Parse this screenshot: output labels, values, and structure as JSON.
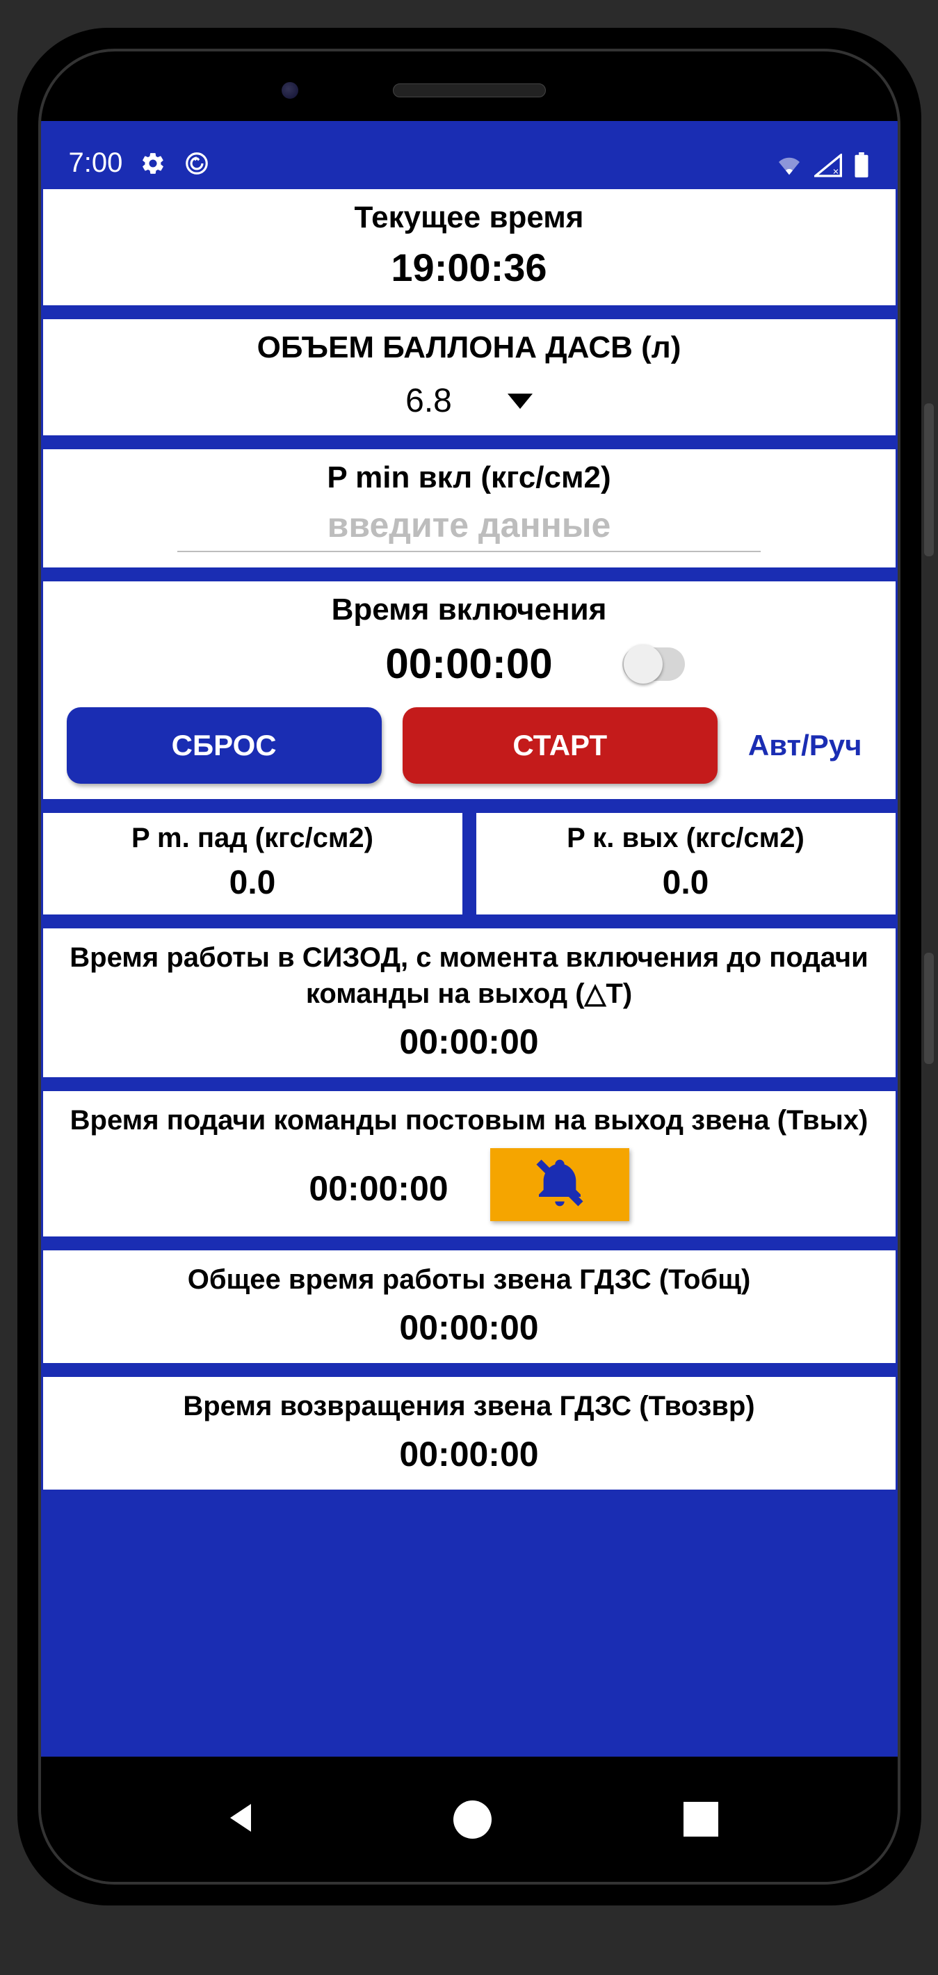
{
  "status": {
    "time": "7:00"
  },
  "current_time": {
    "label": "Текущее время",
    "value": "19:00:36"
  },
  "cylinder": {
    "label": "ОБЪЕМ БАЛЛОНА ДАСВ (л)",
    "value": "6.8"
  },
  "pmin": {
    "label": "P min вкл (кгс/см2)",
    "placeholder": "введите данные"
  },
  "activation": {
    "label": "Время включения",
    "value": "00:00:00",
    "reset_label": "СБРОС",
    "start_label": "СТАРТ",
    "mode_label": "Авт/Руч"
  },
  "pm_pad": {
    "label": "P m. пад (кгс/см2)",
    "value": "0.0"
  },
  "pk_vyh": {
    "label": "P к. вых (кгс/см2)",
    "value": "0.0"
  },
  "work_time_dt": {
    "label": "Время работы в СИЗОД, с момента включения до подачи команды на выход (△T)",
    "value": "00:00:00"
  },
  "exit_cmd": {
    "label": "Время подачи команды постовым на выход звена (Твых)",
    "value": "00:00:00"
  },
  "total_time": {
    "label": "Общее время работы звена ГДЗС (Тобщ)",
    "value": "00:00:00"
  },
  "return_time": {
    "label": "Время возвращения звена ГДЗС (Твозвр)",
    "value": "00:00:00"
  }
}
